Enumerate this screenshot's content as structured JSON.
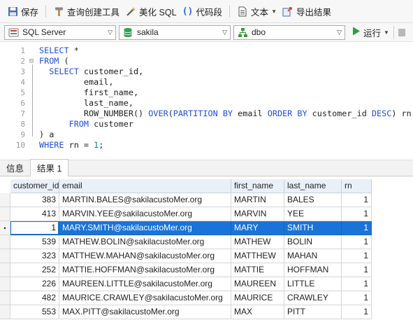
{
  "toolbar": {
    "save": "保存",
    "query_builder": "查询创建工具",
    "beautify": "美化 SQL",
    "snippet": "代码段",
    "text": "文本",
    "export": "导出结果"
  },
  "connection": {
    "server": "SQL Server",
    "database": "sakila",
    "schema": "dbo",
    "run": "运行"
  },
  "editor": {
    "lines": [
      {
        "n": "1",
        "fold": "",
        "tokens": [
          {
            "t": "SELECT",
            "k": "kw"
          },
          {
            "t": " *",
            "k": ""
          }
        ]
      },
      {
        "n": "2",
        "fold": "⊟",
        "tokens": [
          {
            "t": "FROM",
            "k": "kw"
          },
          {
            "t": " (",
            "k": ""
          }
        ]
      },
      {
        "n": "3",
        "fold": "",
        "tokens": [
          {
            "t": "  ",
            "k": ""
          },
          {
            "t": "SELECT",
            "k": "kw"
          },
          {
            "t": " customer_id,",
            "k": ""
          }
        ]
      },
      {
        "n": "4",
        "fold": "",
        "tokens": [
          {
            "t": "         email,",
            "k": ""
          }
        ]
      },
      {
        "n": "5",
        "fold": "",
        "tokens": [
          {
            "t": "         first_name,",
            "k": ""
          }
        ]
      },
      {
        "n": "6",
        "fold": "",
        "tokens": [
          {
            "t": "         last_name,",
            "k": ""
          }
        ]
      },
      {
        "n": "7",
        "fold": "",
        "tokens": [
          {
            "t": "         ROW_NUMBER() ",
            "k": ""
          },
          {
            "t": "OVER",
            "k": "kw"
          },
          {
            "t": "(",
            "k": ""
          },
          {
            "t": "PARTITION BY",
            "k": "kw"
          },
          {
            "t": " email ",
            "k": ""
          },
          {
            "t": "ORDER BY",
            "k": "kw"
          },
          {
            "t": " customer_id ",
            "k": ""
          },
          {
            "t": "DESC",
            "k": "kw"
          },
          {
            "t": ") rn",
            "k": ""
          }
        ]
      },
      {
        "n": "8",
        "fold": "",
        "tokens": [
          {
            "t": "      ",
            "k": ""
          },
          {
            "t": "FROM",
            "k": "kw"
          },
          {
            "t": " customer",
            "k": ""
          }
        ]
      },
      {
        "n": "9",
        "fold": "",
        "tokens": [
          {
            "t": ") a",
            "k": ""
          }
        ]
      },
      {
        "n": "10",
        "fold": "",
        "tokens": [
          {
            "t": "WHERE",
            "k": "kw"
          },
          {
            "t": " rn = ",
            "k": ""
          },
          {
            "t": "1",
            "k": "num"
          },
          {
            "t": ";",
            "k": ""
          }
        ]
      }
    ]
  },
  "tabs": [
    {
      "label": "信息",
      "active": false
    },
    {
      "label": "结果 1",
      "active": true
    }
  ],
  "grid": {
    "columns": [
      "customer_id",
      "email",
      "first_name",
      "last_name",
      "rn"
    ],
    "selected_row": 2,
    "rows": [
      [
        "383",
        "MARTIN.BALES@sakilacustoMer.org",
        "MARTIN",
        "BALES",
        "1"
      ],
      [
        "413",
        "MARVIN.YEE@sakilacustoMer.org",
        "MARVIN",
        "YEE",
        "1"
      ],
      [
        "1",
        "MARY.SMITH@sakilacustoMer.org",
        "MARY",
        "SMITH",
        "1"
      ],
      [
        "539",
        "MATHEW.BOLIN@sakilacustoMer.org",
        "MATHEW",
        "BOLIN",
        "1"
      ],
      [
        "323",
        "MATTHEW.MAHAN@sakilacustoMer.org",
        "MATTHEW",
        "MAHAN",
        "1"
      ],
      [
        "252",
        "MATTIE.HOFFMAN@sakilacustoMer.org",
        "MATTIE",
        "HOFFMAN",
        "1"
      ],
      [
        "226",
        "MAUREEN.LITTLE@sakilacustoMer.org",
        "MAUREEN",
        "LITTLE",
        "1"
      ],
      [
        "482",
        "MAURICE.CRAWLEY@sakilacustoMer.org",
        "MAURICE",
        "CRAWLEY",
        "1"
      ],
      [
        "553",
        "MAX.PITT@sakilacustoMer.org",
        "MAX",
        "PITT",
        "1"
      ]
    ]
  }
}
